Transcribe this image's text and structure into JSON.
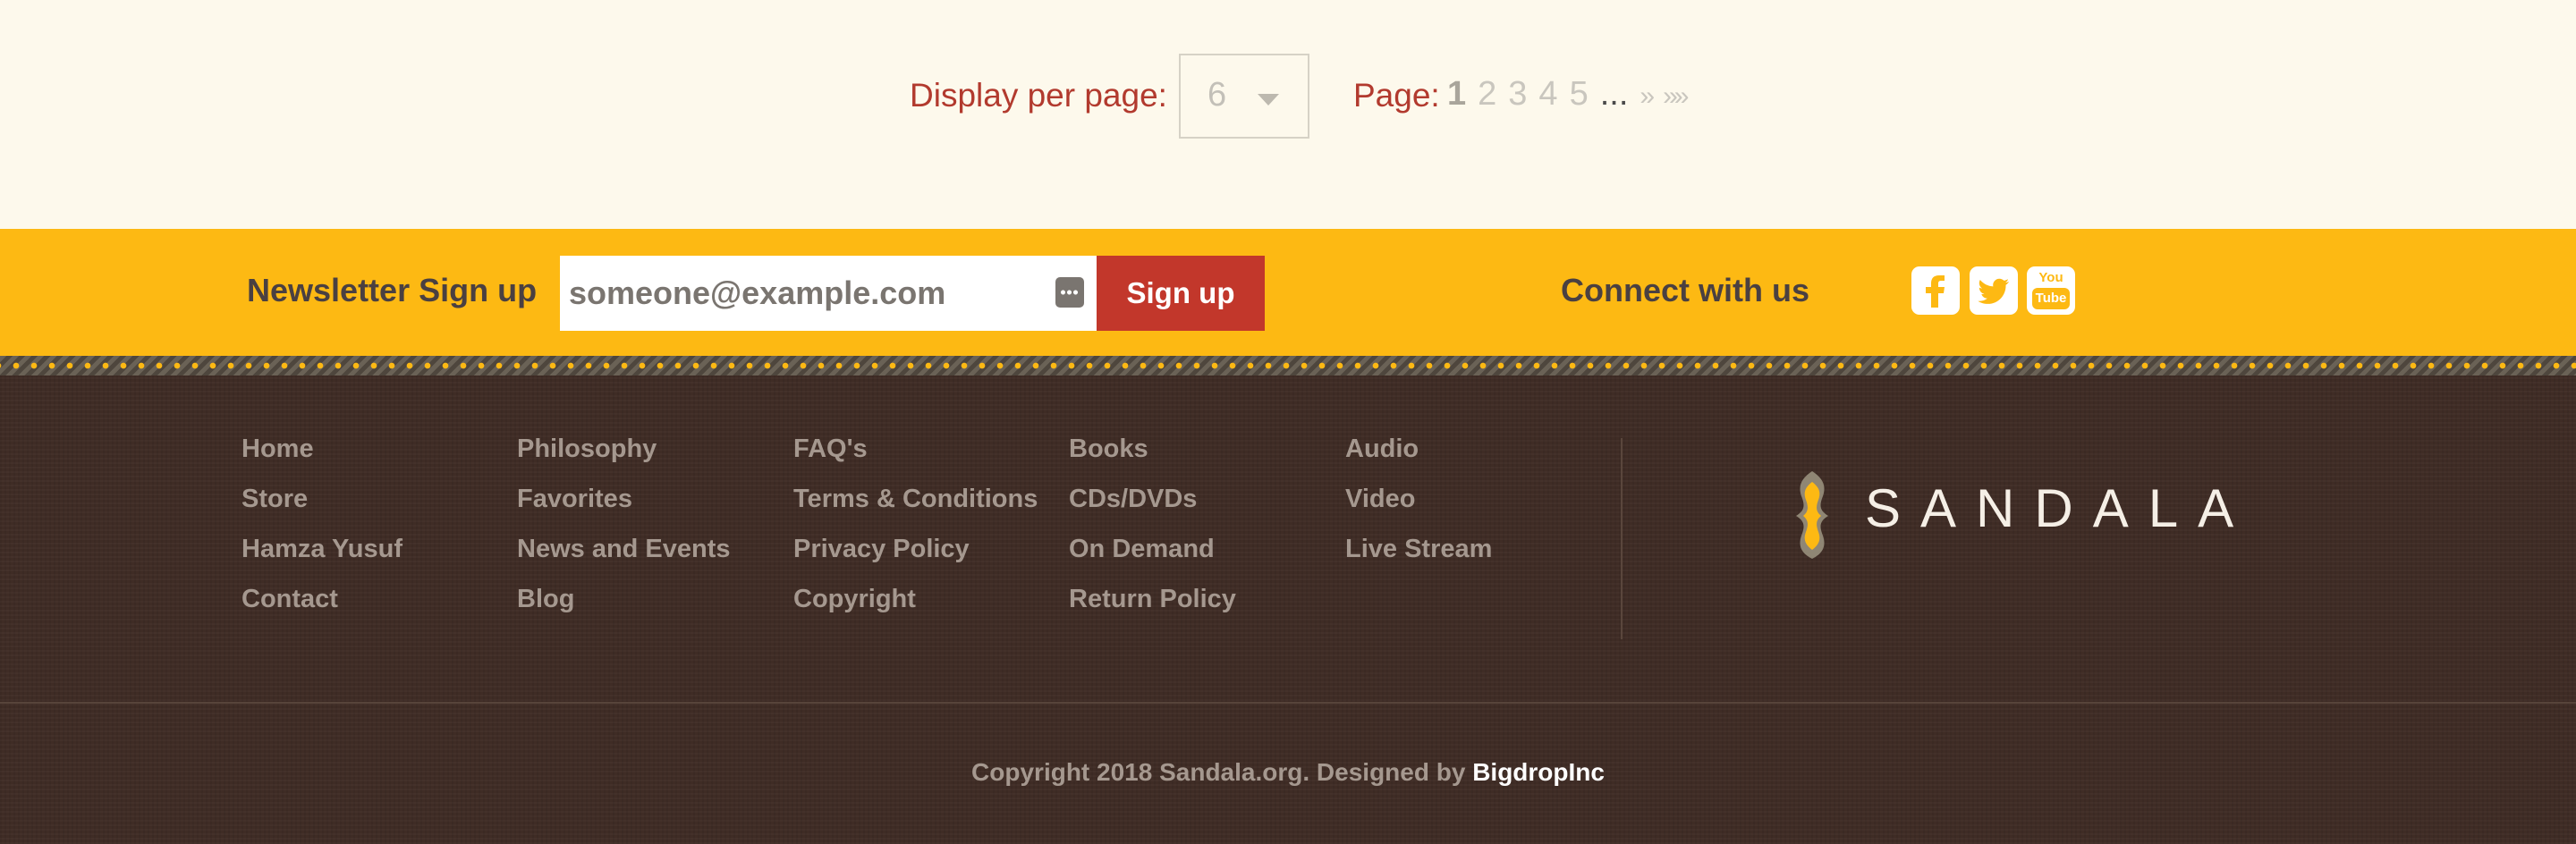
{
  "pagination": {
    "per_page_label": "Display per page:",
    "per_page_value": "6",
    "page_label": "Page:",
    "pages": [
      "1",
      "2",
      "3",
      "4",
      "5"
    ],
    "current_page": "1",
    "ellipsis": "...",
    "next_label": "»",
    "last_label": "»»"
  },
  "newsletter": {
    "title": "Newsletter Sign up",
    "email_placeholder": "someone@example.com",
    "signup_label": "Sign up"
  },
  "connect": {
    "title": "Connect with us",
    "icons": [
      "facebook-icon",
      "twitter-icon",
      "youtube-icon"
    ],
    "youtube_top": "You",
    "youtube_bottom": "Tube"
  },
  "footer": {
    "columns": [
      [
        "Home",
        "Store",
        "Hamza Yusuf",
        "Contact"
      ],
      [
        "Philosophy",
        "Favorites",
        "News and Events",
        "Blog"
      ],
      [
        "FAQ's",
        "Terms & Conditions",
        "Privacy Policy",
        "Copyright"
      ],
      [
        "Books",
        "CDs/DVDs",
        "On Demand",
        "Return Policy"
      ],
      [
        "Audio",
        "Video",
        "Live Stream"
      ]
    ],
    "logo_text": "SANDALA",
    "copyright_text": "Copyright 2018 Sandala.org. Designed by ",
    "designer": "BigdropInc"
  },
  "colors": {
    "accent_red": "#b23a2e",
    "button_red": "#c2372b",
    "bar_yellow": "#fdb913",
    "footer_brown": "#3f2c25",
    "link_gray": "#a5988f"
  }
}
